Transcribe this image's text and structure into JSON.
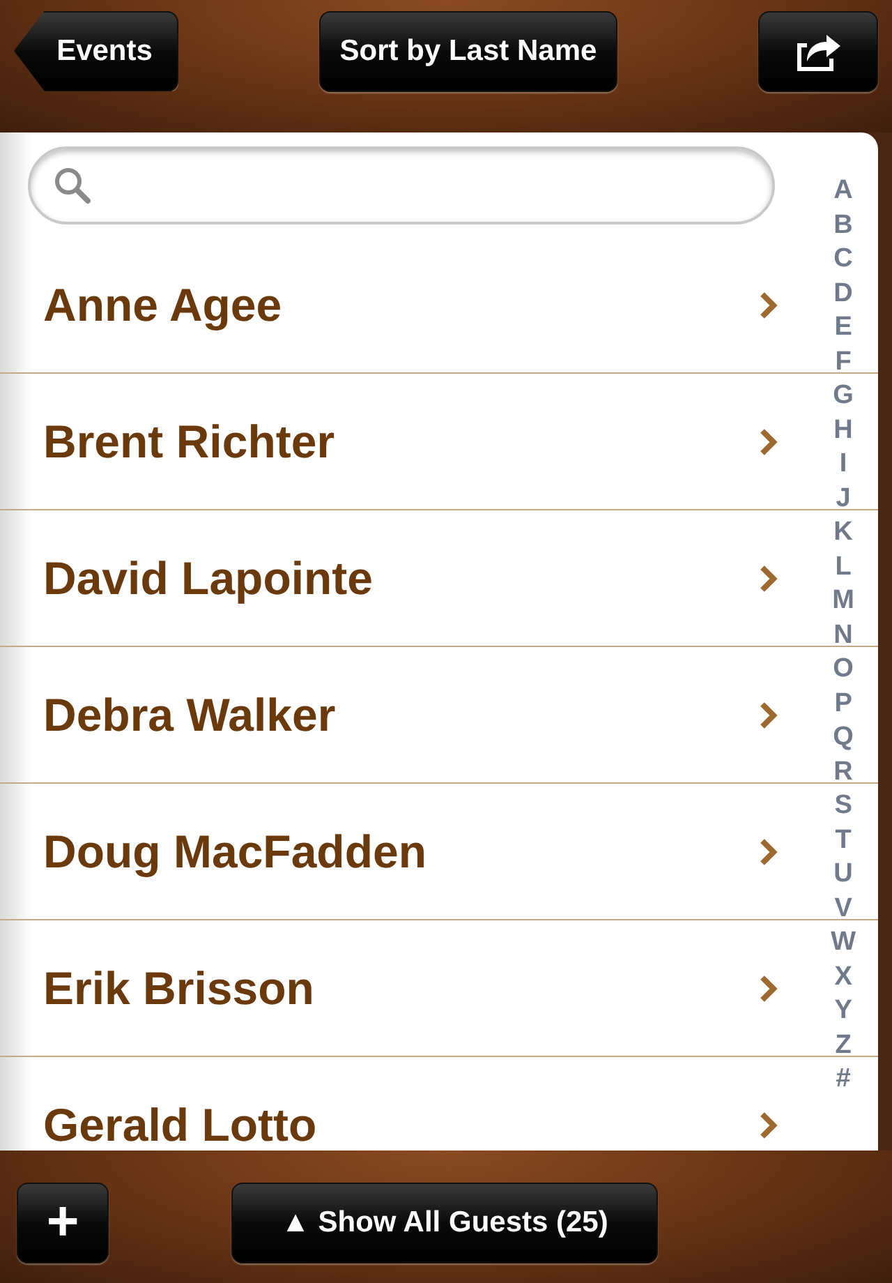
{
  "nav_bar": {
    "back_button": "Events",
    "sort_button": "Sort by Last Name"
  },
  "guests": [
    {
      "name": "Anne Agee"
    },
    {
      "name": "Brent Richter"
    },
    {
      "name": "David Lapointe"
    },
    {
      "name": "Debra Walker"
    },
    {
      "name": "Doug MacFadden"
    },
    {
      "name": "Erik Brisson"
    },
    {
      "name": "Gerald Lotto"
    }
  ],
  "index": [
    "A",
    "B",
    "C",
    "D",
    "E",
    "F",
    "G",
    "H",
    "I",
    "J",
    "K",
    "L",
    "M",
    "N",
    "O",
    "P",
    "Q",
    "R",
    "S",
    "T",
    "U",
    "V",
    "W",
    "X",
    "Y",
    "Z",
    "#"
  ],
  "bottom_bar": {
    "add_button": "+",
    "show_button": "▲ Show All Guests (25)"
  }
}
